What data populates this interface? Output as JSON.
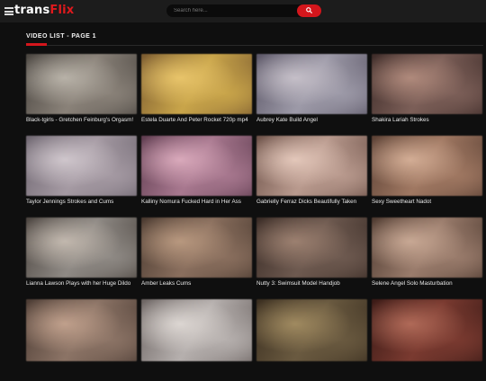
{
  "header": {
    "logo_part1": "trans",
    "logo_part2": "Flix",
    "search_placeholder": "Search here..."
  },
  "section": {
    "title": "VIDEO LIST - PAGE 1"
  },
  "videos": [
    {
      "title": "Black-tgirls - Gretchen Feinburg's Orgasm!",
      "thumb": [
        "#8a8279",
        "#4a4540",
        "#b8b2a8"
      ]
    },
    {
      "title": "Estela Duarte And Peter Rocket 720p mp4",
      "thumb": [
        "#c9a54a",
        "#7a5a30",
        "#e8c46a"
      ]
    },
    {
      "title": "Aubrey Kate Build Angel",
      "thumb": [
        "#9d9aa8",
        "#5b5666",
        "#c5bfc8"
      ]
    },
    {
      "title": "Shakira Lariah Strokes",
      "thumb": [
        "#7c5f58",
        "#3d2b28",
        "#b08a7c"
      ]
    },
    {
      "title": "Taylor Jennings Strokes and Cums",
      "thumb": [
        "#a59aa3",
        "#6e6670",
        "#cfc6cc"
      ]
    },
    {
      "title": "Kalliny Nomura Fucked Hard in Her Ass",
      "thumb": [
        "#a8788f",
        "#5e3c4f",
        "#d9a9bb"
      ]
    },
    {
      "title": "Gabrielly Ferraz Dicks Beautifully Taken",
      "thumb": [
        "#b99a8e",
        "#6c5148",
        "#e3c7ba"
      ]
    },
    {
      "title": "Sexy Sweetheart Nadot",
      "thumb": [
        "#a07862",
        "#5a4034",
        "#d3ad95"
      ]
    },
    {
      "title": "Lianna Lawson Plays with her Huge Dildo",
      "thumb": [
        "#8f8a85",
        "#4c4540",
        "#c2b8ae"
      ]
    },
    {
      "title": "Amber Leaks Cums",
      "thumb": [
        "#8a6f5e",
        "#4a3a30",
        "#b8987f"
      ]
    },
    {
      "title": "Nutty 3: Swimsuit Model Handjob",
      "thumb": [
        "#6e5a50",
        "#3a2c26",
        "#9c8070"
      ]
    },
    {
      "title": "Selene Angel Solo Masturbation",
      "thumb": [
        "#9a7c6c",
        "#4e3a30",
        "#c8a894"
      ]
    },
    {
      "title": "",
      "thumb": [
        "#8c7466",
        "#4c3c34",
        "#c0a08c"
      ]
    },
    {
      "title": "",
      "thumb": [
        "#b6b0ae",
        "#6c6462",
        "#dcd6d2"
      ]
    },
    {
      "title": "",
      "thumb": [
        "#6a5a40",
        "#3a2e20",
        "#a08a60"
      ]
    },
    {
      "title": "",
      "thumb": [
        "#7a3a30",
        "#3a1a16",
        "#b06a58"
      ]
    }
  ],
  "colors": {
    "accent": "#d4161c",
    "background": "#0f0f0f",
    "topbar": "#1c1c1c"
  }
}
